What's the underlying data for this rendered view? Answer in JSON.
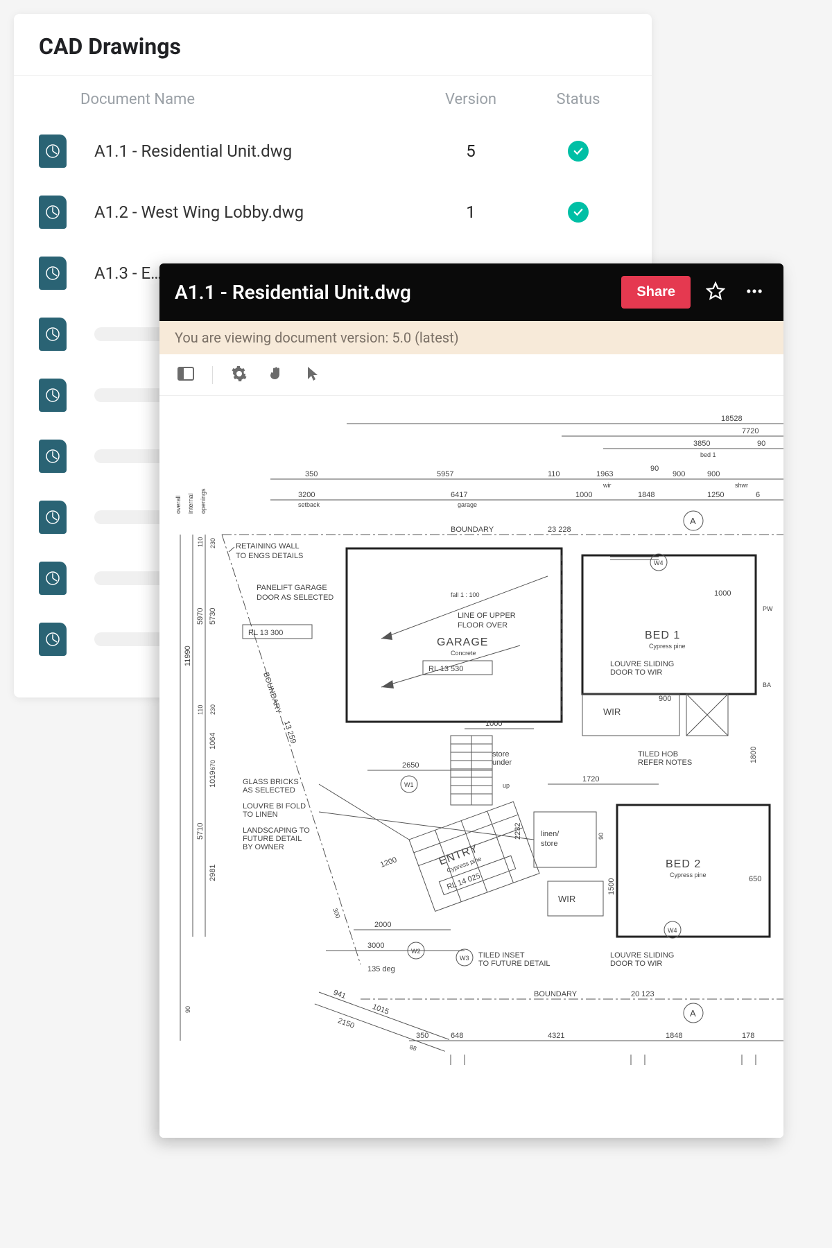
{
  "list": {
    "title": "CAD Drawings",
    "columns": {
      "name": "Document Name",
      "version": "Version",
      "status": "Status"
    },
    "rows": [
      {
        "name": "A1.1 - Residential Unit.dwg",
        "version": "5",
        "status": "ok"
      },
      {
        "name": "A1.2 - West Wing Lobby.dwg",
        "version": "1",
        "status": "ok"
      },
      {
        "name": "A1.3 - E…",
        "version": "",
        "status": ""
      }
    ],
    "placeholder_count": 6
  },
  "viewer": {
    "title": "A1.1 - Residential Unit.dwg",
    "share_label": "Share",
    "version_notice": "You are viewing document version: 5.0 (latest)"
  },
  "cad": {
    "side_labels": [
      "overall",
      "internal",
      "openings"
    ],
    "top_dims": {
      "d18528": "18528",
      "d7720": "7720",
      "d3850": "3850",
      "d90a": "90",
      "bed1lbl": "bed 1",
      "d350": "350",
      "d5957": "5957",
      "d110a": "110",
      "d1963": "1963",
      "d90b": "90",
      "d900a": "900",
      "d900b": "900",
      "wirlbl": "wir",
      "shwrlbl": "shwr",
      "d3200": "3200",
      "setback": "setback",
      "d6417": "6417",
      "garagelbl": "garage",
      "d1000a": "1000",
      "d1848a": "1848",
      "d1250": "1250",
      "d6": "6"
    },
    "notes": {
      "retain": "RETAINING WALL\nTO ENGS DETAILS",
      "panelift": "PANELIFT GARAGE\nDOOR AS SELECTED",
      "lineupper": "LINE OF UPPER\nFLOOR OVER",
      "louvre1": "LOUVRE SLIDING\nDOOR TO WIR",
      "tiledhob": "TILED HOB\nREFER NOTES",
      "glass": "GLASS BRICKS\nAS SELECTED",
      "louvrebi": "LOUVRE BI FOLD\nTO LINEN",
      "landscape": "LANDSCAPING TO\nFUTURE DETAIL\nBY OWNER",
      "tiledinset": "TILED INSET\nTO FUTURE DETAIL",
      "louvre2": "LOUVRE SLIDING\nDOOR TO WIR"
    },
    "rooms": {
      "garage": "GARAGE",
      "garage_sub": "Concrete",
      "bed1": "BED 1",
      "bed1_sub": "Cypress pine",
      "entry": "ENTRY",
      "entry_sub": "Cypress pine",
      "bed2": "BED 2",
      "bed2_sub": "Cypress pine",
      "wir1": "WIR",
      "wir2": "WIR",
      "linen": "linen/\nstore",
      "store": "store\nunder",
      "ba": "BA",
      "pw": "PW"
    },
    "rl": {
      "a": "RL 13 300",
      "b": "RL 13 530",
      "c": "RL 14 025"
    },
    "boundary": {
      "label": "BOUNDARY",
      "top": "23 228",
      "bottom": "20 123",
      "diag": "13 259",
      "side": "BOUNDARY"
    },
    "misc": {
      "fall": "fall   1 : 100",
      "d1000b": "1000",
      "d1000c": "1000",
      "d900c": "900",
      "d1720": "1720",
      "d2650": "2650",
      "d2000": "2000",
      "d3000": "3000",
      "d135deg": "135 deg",
      "d941": "941",
      "d1015": "1015",
      "d2150": "2150",
      "d88": "88",
      "d350b": "350",
      "d648": "648",
      "d4321": "4321",
      "d1848b": "1848",
      "d178": "178",
      "d1800": "1800",
      "d650": "650",
      "d1500": "1500",
      "d90c": "90",
      "d110b": "110",
      "d230a": "230",
      "d5970": "5970",
      "d5730": "5730",
      "d11990": "11990",
      "d110c": "110",
      "d230b": "230",
      "d1064": "1064",
      "d1019": "1019",
      "d670": "670",
      "d5710": "5710",
      "d2981": "2981",
      "d90v": "90",
      "d2232": "2232",
      "d1200": "1200",
      "d300": "300",
      "up": "up",
      "circA": "A",
      "w2": "W2",
      "w3": "W3",
      "w4": "W4",
      "w1": "W1"
    }
  }
}
